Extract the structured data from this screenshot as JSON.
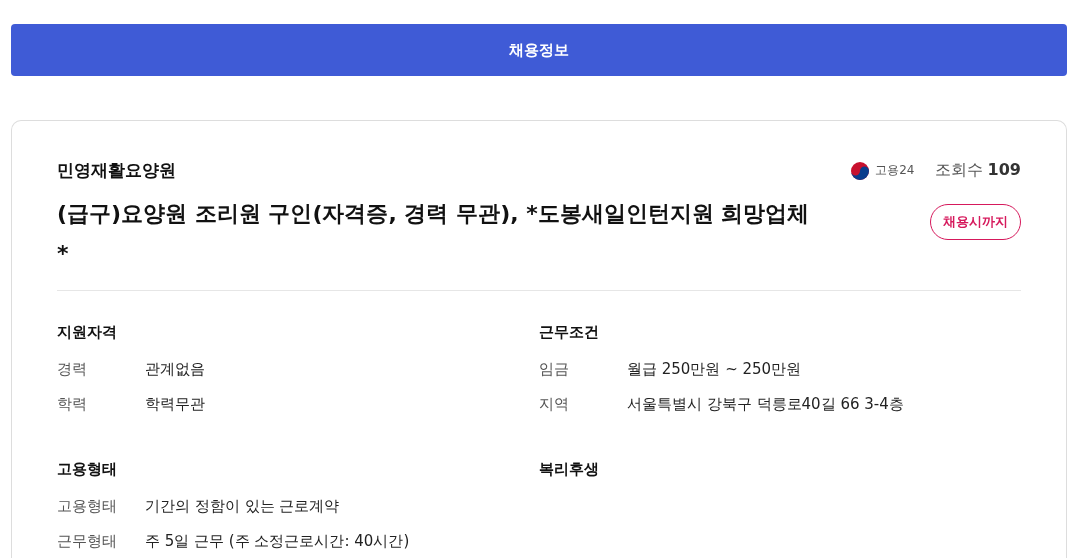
{
  "header": {
    "title": "채용정보"
  },
  "posting": {
    "company": "민영재활요양원",
    "source": "고용24",
    "views_label": "조회수",
    "views": "109",
    "title": "(급구)요양원 조리원 구인(자격증, 경력 무관), *도봉새일인턴지원 희망업체 *",
    "deadline": "채용시까지"
  },
  "sections": [
    {
      "title": "지원자격",
      "rows": [
        {
          "label": "경력",
          "value": "관계없음"
        },
        {
          "label": "학력",
          "value": "학력무관"
        }
      ]
    },
    {
      "title": "근무조건",
      "rows": [
        {
          "label": "임금",
          "value": "월급 250만원 ~ 250만원"
        },
        {
          "label": "지역",
          "value": "서울특별시 강북구 덕릉로40길 66 3-4층"
        }
      ]
    },
    {
      "title": "고용형태",
      "rows": [
        {
          "label": "고용형태",
          "value": "기간의 정함이 있는 근로계약"
        },
        {
          "label": "근무형태",
          "value": "주 5일 근무 (주 소정근로시간: 40시간)"
        }
      ]
    },
    {
      "title": "복리후생"
    }
  ]
}
